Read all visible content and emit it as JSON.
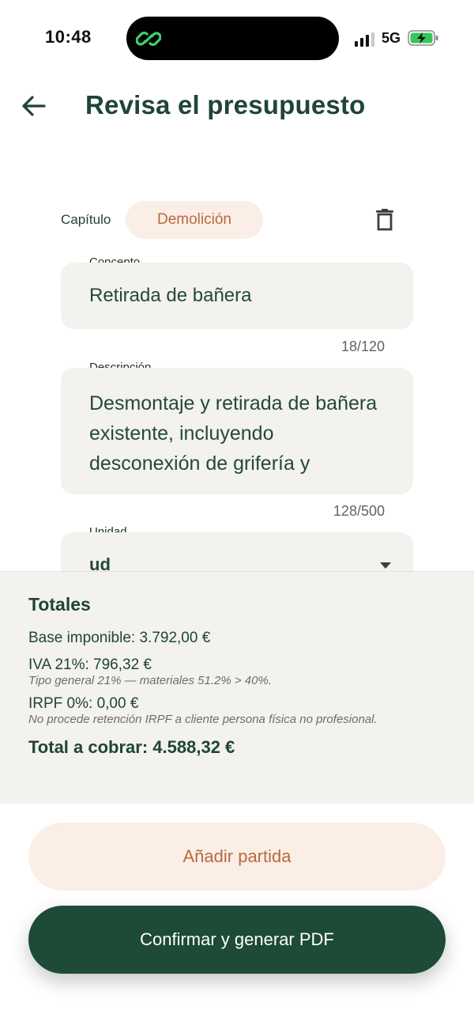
{
  "status_bar": {
    "time": "10:48",
    "network": "5G",
    "app_icon": "link-icon",
    "signal_icon": "signal-icon",
    "battery_icon": "battery-charging-icon"
  },
  "header": {
    "back_icon": "arrow-left-icon",
    "title": "Revisa el presupuesto"
  },
  "item": {
    "chapter_label": "Capítulo",
    "chapter_value": "Demolición",
    "delete_icon": "trash-icon",
    "concept": {
      "label": "Concepto",
      "value": "Retirada de bañera",
      "counter": "18/120"
    },
    "description": {
      "label": "Descripción",
      "value": "Desmontaje y retirada de bañera existente, incluyendo desconexión de grifería y",
      "counter": "128/500"
    },
    "unit": {
      "label": "Unidad",
      "value": "ud",
      "dropdown_icon": "chevron-down-icon"
    }
  },
  "totals": {
    "title": "Totales",
    "base": "Base imponible: 3.792,00 €",
    "iva": "IVA 21%: 796,32 €",
    "iva_note": "Tipo general 21% — materiales 51.2% > 40%.",
    "irpf": "IRPF 0%: 0,00 €",
    "irpf_note": "No procede retención IRPF a cliente persona física no profesional.",
    "total": "Total a cobrar: 4.588,32 €"
  },
  "actions": {
    "add_label": "Añadir partida",
    "confirm_label": "Confirmar y generar PDF"
  },
  "colors": {
    "primary": "#1e4a38",
    "accent": "#b86a3e",
    "accent_bg": "#fbeee6",
    "field_bg": "#f3f2ee"
  }
}
